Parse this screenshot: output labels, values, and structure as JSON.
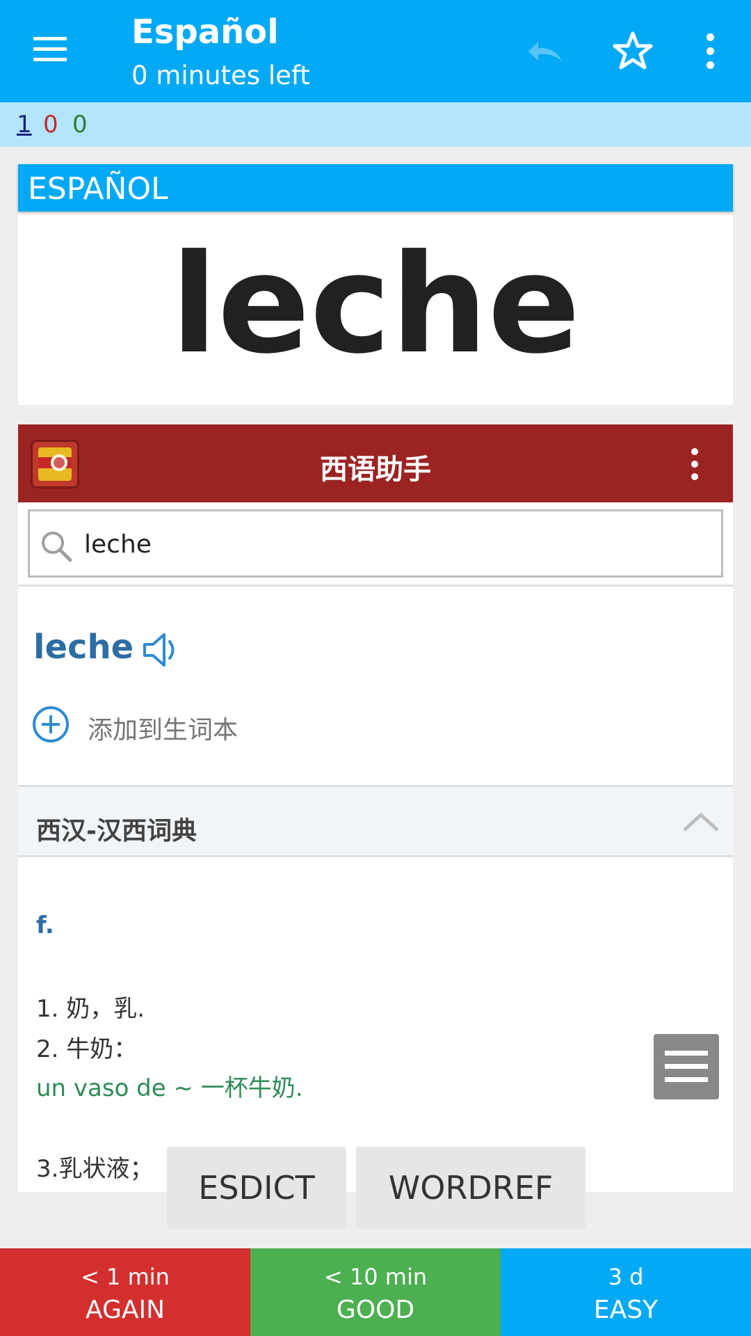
{
  "appbar": {
    "title": "Español",
    "subtitle": "0 minutes left",
    "icons": [
      "menu-icon",
      "undo-icon",
      "star-icon",
      "more-vert-icon"
    ],
    "background": "#03a9f4"
  },
  "counts": {
    "new": "1",
    "learning": "0",
    "review": "0",
    "colors": {
      "new": "#1a237e",
      "learning": "#c62828",
      "review": "#2e7d32"
    }
  },
  "card": {
    "deck_label": "ESPAÑOL",
    "front_word": "leche"
  },
  "dictionary": {
    "app_title": "西语助手",
    "search_value": "leche",
    "entry_word": "leche",
    "add_to_wordbook": "添加到生词本",
    "section_title": "西汉-汉西词典",
    "part_of_speech": "f.",
    "definitions": [
      "1. 奶，乳.",
      "2. 牛奶："
    ],
    "example": "un vaso de ~ 一杯牛奶.",
    "definition3": "3.乳状液；",
    "bar_color": "#9b2423"
  },
  "dict_buttons": {
    "esdict": "ESDICT",
    "wordref": "WORDREF"
  },
  "answers": [
    {
      "interval": "< 1 min",
      "label": "AGAIN",
      "color": "#d32f2f"
    },
    {
      "interval": "< 10 min",
      "label": "GOOD",
      "color": "#4caf50"
    },
    {
      "interval": "3 d",
      "label": "EASY",
      "color": "#03a9f4"
    }
  ]
}
